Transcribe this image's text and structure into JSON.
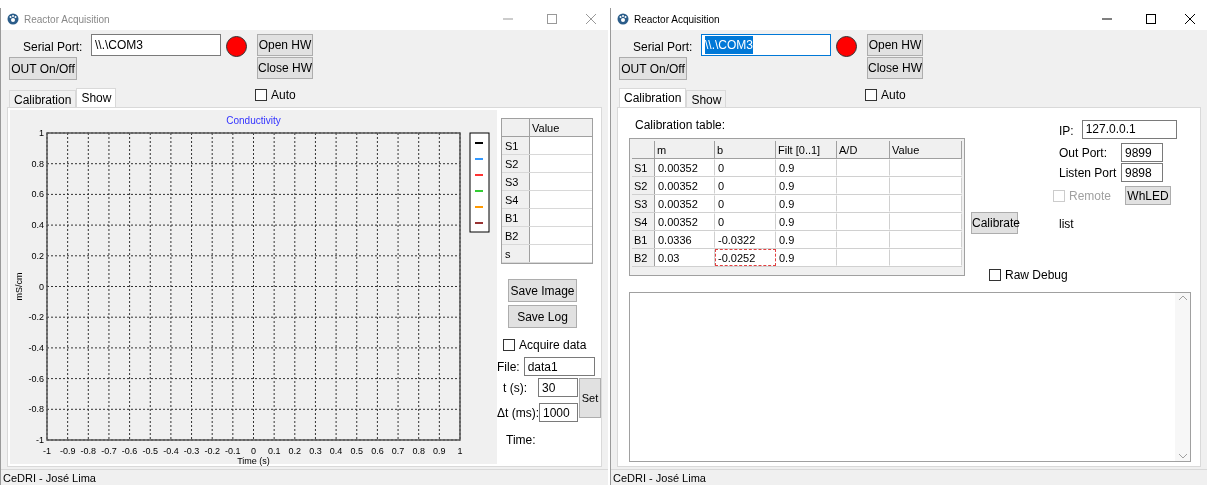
{
  "windows": [
    {
      "title": "Reactor Acquisition",
      "active": false,
      "serial_port": {
        "label": "Serial Port:",
        "value": "\\\\.\\COM3",
        "text_selected": false
      },
      "connected": false,
      "out_button": "OUT On/Off",
      "open_button": "Open HW",
      "close_button": "Close HW",
      "auto": {
        "label": "Auto",
        "checked": false
      },
      "tabs": [
        {
          "label": "Calibration",
          "selected": false
        },
        {
          "label": "Show",
          "selected": true
        }
      ],
      "panel": {
        "kind": "show",
        "chart": {
          "chart_data": {
            "type": "line",
            "grid": true,
            "title": "Conductivity",
            "xlabel": "Time (s)",
            "ylabel": "mS/cm",
            "xlim": [
              -1,
              1
            ],
            "ylim": [
              -1,
              1
            ],
            "xticks": [
              -1,
              -0.9,
              -0.8,
              -0.7,
              -0.6,
              -0.5,
              -0.4,
              -0.3,
              -0.2,
              -0.1,
              0,
              0.1,
              0.2,
              0.3,
              0.4,
              0.5,
              0.6,
              0.7,
              0.8,
              0.9,
              1
            ],
            "yticks": [
              -1,
              -0.8,
              -0.6,
              -0.4,
              -0.2,
              0,
              0.2,
              0.4,
              0.6,
              0.8,
              1
            ]
          },
          "legend": [
            {
              "color": "#000000"
            },
            {
              "color": "#3399ff"
            },
            {
              "color": "#ff3333"
            },
            {
              "color": "#33cc33"
            },
            {
              "color": "#ff9900"
            },
            {
              "color": "#993333"
            }
          ]
        },
        "values_table": {
          "column": "Value",
          "rows": [
            {
              "label": "S1"
            },
            {
              "label": "S2"
            },
            {
              "label": "S3"
            },
            {
              "label": "S4"
            },
            {
              "label": "B1"
            },
            {
              "label": "B2"
            },
            {
              "label": "s"
            }
          ]
        },
        "save_image": "Save Image",
        "save_log": "Save Log",
        "acquire": {
          "label": "Acquire data",
          "checked": false
        },
        "file": {
          "label": "File:",
          "value": "data1"
        },
        "duration": {
          "label": "t (s):",
          "value": "30"
        },
        "interval": {
          "label": "Δt (ms):",
          "value": "1000"
        },
        "set_button": "Set",
        "time_label": "Time:"
      },
      "status_bar": "CeDRI - José Lima"
    },
    {
      "title": "Reactor Acquisition",
      "active": true,
      "serial_port": {
        "label": "Serial Port:",
        "value": "\\\\.\\COM3",
        "text_selected": true
      },
      "connected": false,
      "out_button": "OUT On/Off",
      "open_button": "Open HW",
      "close_button": "Close HW",
      "auto": {
        "label": "Auto",
        "checked": false
      },
      "tabs": [
        {
          "label": "Calibration",
          "selected": true
        },
        {
          "label": "Show",
          "selected": false
        }
      ],
      "panel": {
        "kind": "calibration",
        "table_title": "Calibration table:",
        "columns": [
          "m",
          "b",
          "Filt [0..1]",
          "A/D",
          "Value"
        ],
        "rows": [
          {
            "label": "S1",
            "cells": [
              {
                "text": "0.00352",
                "focused": false
              },
              {
                "text": "0",
                "focused": false
              },
              {
                "text": "0.9",
                "focused": false
              }
            ]
          },
          {
            "label": "S2",
            "cells": [
              {
                "text": "0.00352",
                "focused": false
              },
              {
                "text": "0",
                "focused": false
              },
              {
                "text": "0.9",
                "focused": false
              }
            ]
          },
          {
            "label": "S3",
            "cells": [
              {
                "text": "0.00352",
                "focused": false
              },
              {
                "text": "0",
                "focused": false
              },
              {
                "text": "0.9",
                "focused": false
              }
            ]
          },
          {
            "label": "S4",
            "cells": [
              {
                "text": "0.00352",
                "focused": false
              },
              {
                "text": "0",
                "focused": false
              },
              {
                "text": "0.9",
                "focused": false
              }
            ]
          },
          {
            "label": "B1",
            "cells": [
              {
                "text": "0.0336",
                "focused": false
              },
              {
                "text": "-0.0322",
                "focused": false
              },
              {
                "text": "0.9",
                "focused": false
              }
            ]
          },
          {
            "label": "B2",
            "cells": [
              {
                "text": "0.03",
                "focused": false
              },
              {
                "text": "-0.0252",
                "focused": true
              },
              {
                "text": "0.9",
                "focused": false
              }
            ]
          }
        ],
        "calibrate_button": "Calibrate",
        "ip": {
          "label": "IP:",
          "value": "127.0.0.1"
        },
        "out_port": {
          "label": "Out Port:",
          "value": "9899"
        },
        "listen_port": {
          "label": "Listen Port",
          "value": "9898"
        },
        "remote": {
          "label": "Remote",
          "checked": false,
          "disabled": true
        },
        "whled_button": "WhLED",
        "list_label": "list",
        "raw_debug": {
          "label": "Raw Debug",
          "checked": false
        }
      },
      "status_bar": "CeDRI - José Lima"
    }
  ]
}
